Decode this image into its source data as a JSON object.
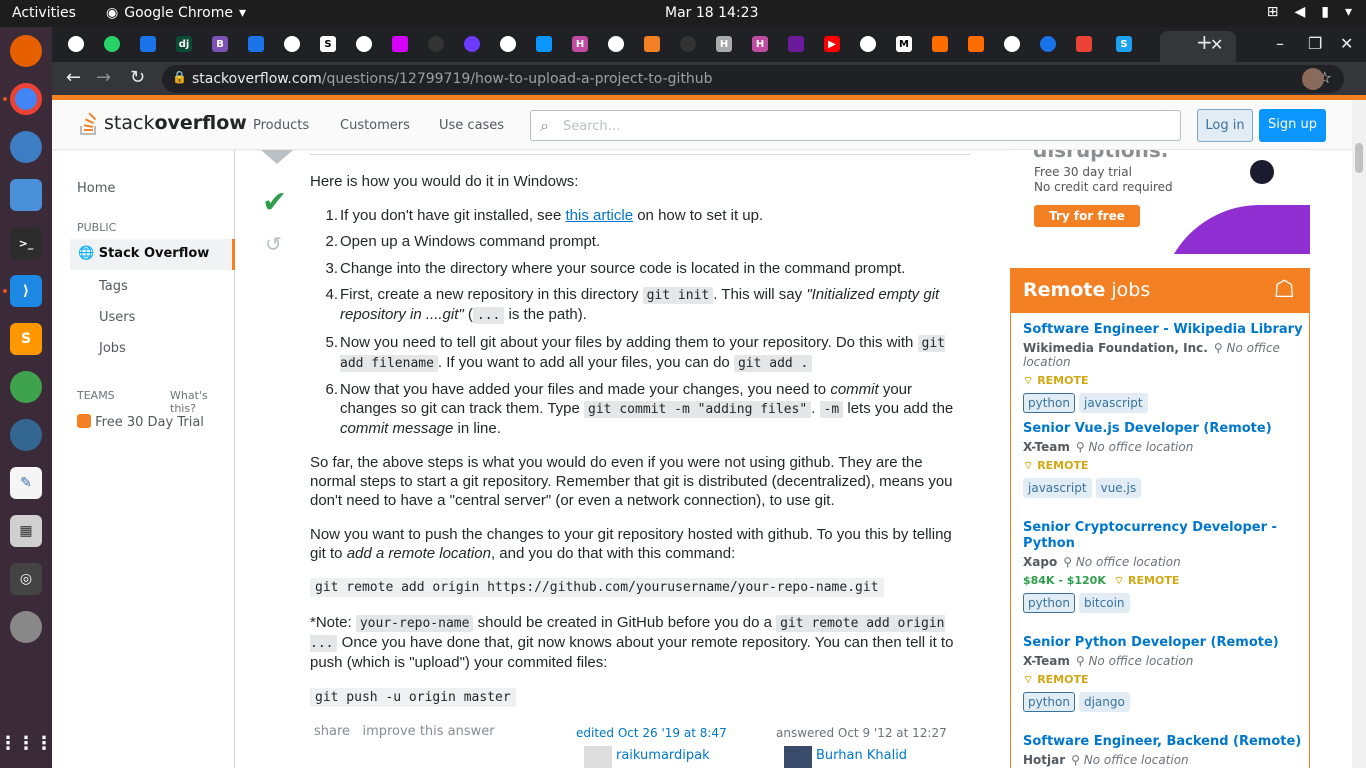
{
  "os": {
    "activities": "Activities",
    "app_name": "Google Chrome",
    "clock": "Mar 18  14:23"
  },
  "browser": {
    "url_host": "stackoverflow.com",
    "url_path": "/questions/12799719/how-to-upload-a-project-to-github"
  },
  "header": {
    "logo_light": "stack",
    "logo_bold": "overflow",
    "nav": [
      "Products",
      "Customers",
      "Use cases"
    ],
    "search_placeholder": "Search…",
    "login": "Log in",
    "signup": "Sign up"
  },
  "leftnav": {
    "home": "Home",
    "public": "PUBLIC",
    "stack_overflow": "Stack Overflow",
    "tags": "Tags",
    "users": "Users",
    "jobs": "Jobs",
    "teams": "TEAMS",
    "whats_this": "What's this?",
    "trial": "Free 30 Day Trial"
  },
  "answer": {
    "intro": "Here is how you would do it in Windows:",
    "steps": [
      {
        "n": "1.",
        "a": "If you don't have git installed, see ",
        "link": "this article",
        "b": " on how to set it up."
      },
      {
        "n": "2.",
        "a": "Open up a Windows command prompt."
      },
      {
        "n": "3.",
        "a": "Change into the directory where your source code is located in the command prompt."
      },
      {
        "n": "4.",
        "a": "First, create a new repository in this directory ",
        "code1": "git init",
        "b": ". This will say ",
        "em1": "\"Initialized empty git repository in ....git\"",
        "c": " (",
        "code2": "...",
        "d": " is the path)."
      },
      {
        "n": "5.",
        "a": "Now you need to tell git about your files by adding them to your repository. Do this with ",
        "code1": "git add filename",
        "b": ". If you want to add all your files, you can do ",
        "code2": "git add ."
      },
      {
        "n": "6.",
        "a": "Now that you have added your files and made your changes, you need to ",
        "em1": "commit",
        "b": " your changes so git can track them. Type ",
        "code1": "git commit -m \"adding files\"",
        "c": ". ",
        "code2": "-m",
        "d": " lets you add the ",
        "em2": "commit message",
        "e": " in line."
      }
    ],
    "para1": "So far, the above steps is what you would do even if you were not using github. They are the normal steps to start a git repository. Remember that git is distributed (decentralized), means you don't need to have a \"central server\" (or even a network connection), to use git.",
    "para2a": "Now you want to push the changes to your git repository hosted with github. To you this by telling git to ",
    "para2em": "add a remote location",
    "para2b": ", and you do that with this command:",
    "code_remote": "git remote add origin https://github.com/yourusername/your-repo-name.git",
    "note_a": "*Note: ",
    "note_code1": "your-repo-name",
    "note_b": " should be created in GitHub before you do a ",
    "note_code2": "git remote add origin ...",
    "note_c": " Once you have done that, git now knows about your remote repository. You can then tell it to push (which is \"upload\") your commited files:",
    "code_push": "git push -u origin master",
    "share": "share",
    "improve": "improve this answer",
    "edited": "edited Oct 26 '19 at 8:47",
    "editor": "raikumardipak",
    "answered": "answered Oct 9 '12 at 12:27",
    "author": "Burhan Khalid"
  },
  "ad": {
    "heading": "disruptions.",
    "line1": "Free 30 day trial",
    "line2": "No credit card required",
    "cta": "Try for free"
  },
  "jobs": {
    "head_bold": "Remote",
    "head_rest": " jobs",
    "no_office": "No office location",
    "remote": "REMOTE",
    "items": [
      {
        "title": "Software Engineer - Wikipedia Library",
        "company": "Wikimedia Foundation, Inc.",
        "tags": [
          "python",
          "javascript"
        ]
      },
      {
        "title": "Senior Vue.js Developer (Remote)",
        "company": "X-Team",
        "tags": [
          "javascript",
          "vue.js"
        ]
      },
      {
        "title": "Senior Cryptocurrency Developer - Python",
        "company": "Xapo",
        "salary": "$84K - $120K",
        "tags": [
          "python",
          "bitcoin"
        ]
      },
      {
        "title": "Senior Python Developer (Remote)",
        "company": "X-Team",
        "tags": [
          "python",
          "django"
        ]
      },
      {
        "title": "Software Engineer, Backend (Remote)",
        "company": "Hotjar"
      }
    ]
  }
}
